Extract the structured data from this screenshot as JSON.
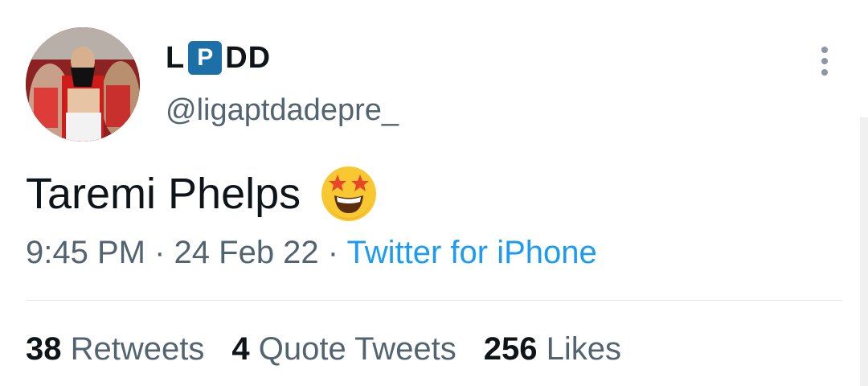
{
  "user": {
    "name_left": "L",
    "name_badge": "P",
    "name_right": "DD",
    "handle": "@ligaptdadepre_"
  },
  "tweet": {
    "text": "Taremi Phelps",
    "emoji": "star-struck-emoji",
    "time": "9:45 PM",
    "separator": "·",
    "date": "24 Feb 22",
    "source": "Twitter for iPhone"
  },
  "stats": {
    "retweets_count": "38",
    "retweets_label": "Retweets",
    "quotes_count": "4",
    "quotes_label": "Quote Tweets",
    "likes_count": "256",
    "likes_label": "Likes"
  },
  "icons": {
    "more": "more-vertical-icon"
  },
  "colors": {
    "badge": "#1d6fa8",
    "link": "#1d9bf0",
    "secondary_text": "#536471"
  }
}
